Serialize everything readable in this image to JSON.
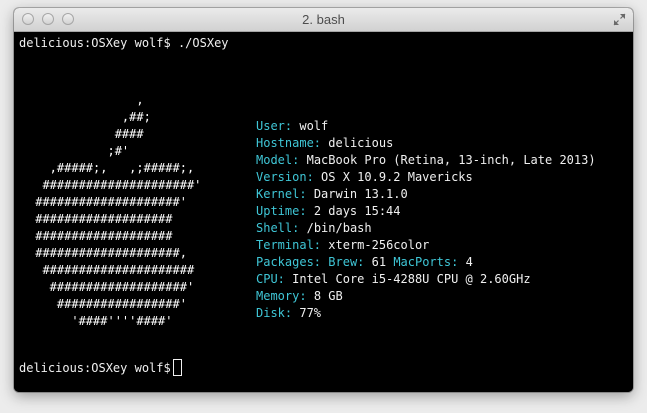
{
  "window": {
    "title": "2. bash"
  },
  "terminal": {
    "prompt": "delicious:OSXey wolf$",
    "command": "./OSXey",
    "final_prompt": "delicious:OSXey wolf$",
    "logo_lines": [
      "               ,",
      "             ,##;",
      "            ####",
      "           ;#'",
      "   ,#####;,   ,;#####;,",
      "  #####################'",
      " ####################'",
      " ###################",
      " ###################",
      " ####################,",
      "  #####################",
      "   ###################'",
      "    #################'",
      "      '####''''####'"
    ],
    "info": [
      {
        "key": "User:",
        "value": "wolf"
      },
      {
        "key": "Hostname:",
        "value": "delicious"
      },
      {
        "key": "Model:",
        "value": "MacBook Pro (Retina, 13-inch, Late 2013)"
      },
      {
        "key": "Version:",
        "value": "OS X 10.9.2 Mavericks"
      },
      {
        "key": "Kernel:",
        "value": "Darwin 13.1.0"
      },
      {
        "key": "Uptime:",
        "value": "2 days 15:44"
      },
      {
        "key": "Shell:",
        "value": "/bin/bash"
      },
      {
        "key": "Terminal:",
        "value": "xterm-256color"
      },
      {
        "key": "Packages:",
        "value_parts": [
          {
            "text": "Brew:",
            "accent": true
          },
          {
            "text": "61",
            "accent": false
          },
          {
            "text": "MacPorts:",
            "accent": true
          },
          {
            "text": "4",
            "accent": false
          }
        ]
      },
      {
        "key": "CPU:",
        "value": "Intel Core i5-4288U CPU @ 2.60GHz"
      },
      {
        "key": "Memory:",
        "value": "8 GB"
      },
      {
        "key": "Disk:",
        "value": "77%"
      }
    ]
  },
  "colors": {
    "accent": "#3fc6d6",
    "text": "#f0f0f0",
    "background": "#000000"
  },
  "icons": [
    "close-icon",
    "minimize-icon",
    "zoom-icon",
    "fullscreen-icon"
  ]
}
